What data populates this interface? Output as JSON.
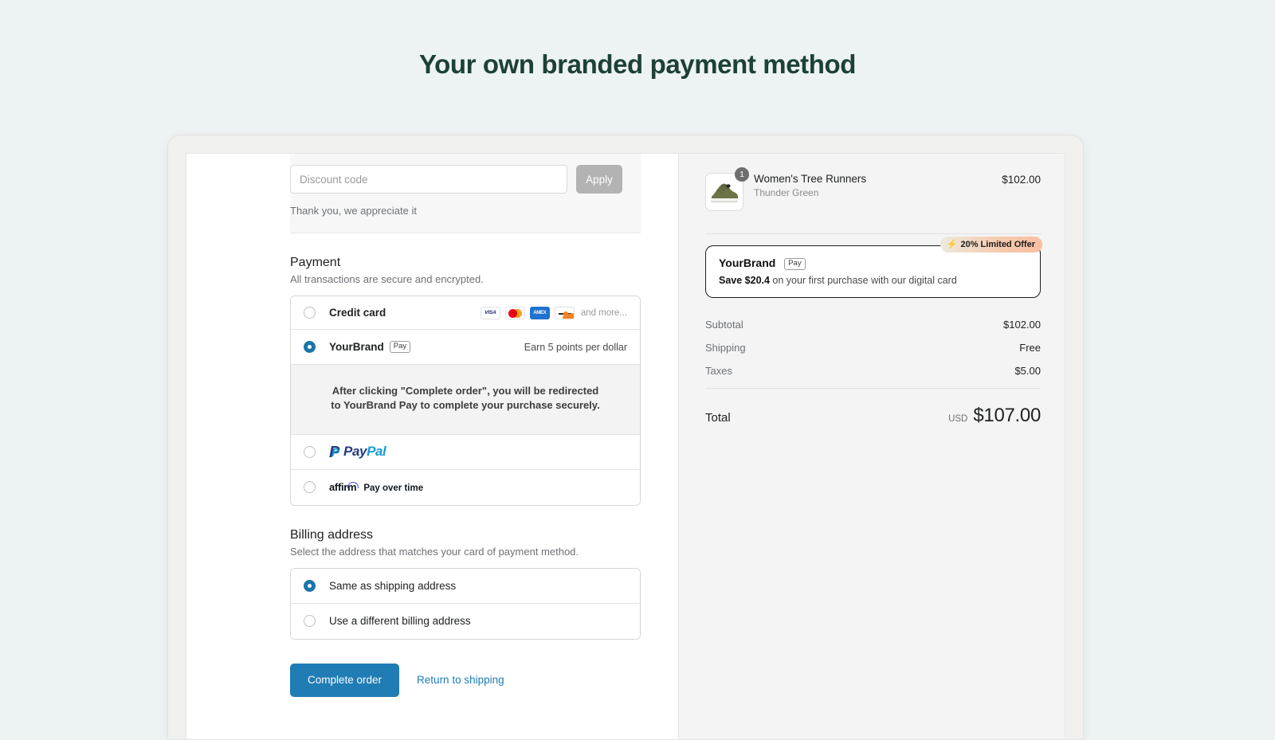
{
  "page": {
    "title": "Your own branded payment method",
    "title_color": "#1d4038",
    "background_color": "#edf3f2",
    "accent_color": "#1f7cb4"
  },
  "discount": {
    "placeholder": "Discount code",
    "value": "",
    "apply_label": "Apply",
    "note": "Thank you, we appreciate it"
  },
  "payment": {
    "title": "Payment",
    "subtitle": "All transactions are secure and encrypted.",
    "methods": [
      {
        "label": "Credit card",
        "selected": false,
        "cards": [
          "VISA",
          "mastercard",
          "AMEX",
          "discover"
        ],
        "and_more": "and more..."
      },
      {
        "label": "YourBrand",
        "tag": "Pay",
        "selected": true,
        "right_note": "Earn 5 points per dollar",
        "redirect_note_line1": "After clicking \"Complete order\", you will be redirected",
        "redirect_note_line2": "to YourBrand Pay to complete your purchase securely."
      },
      {
        "label": "PayPal",
        "logo_part_a": "Pay",
        "logo_part_b": "Pal",
        "selected": false
      },
      {
        "label": "affirm",
        "tagline": "Pay over time",
        "selected": false
      }
    ]
  },
  "billing": {
    "title": "Billing address",
    "subtitle": "Select the address that matches your card of payment method.",
    "options": [
      {
        "label": "Same as shipping address",
        "selected": true
      },
      {
        "label": "Use a different billing address",
        "selected": false
      }
    ]
  },
  "actions": {
    "primary_label": "Complete order",
    "secondary_label": "Return to shipping"
  },
  "summary": {
    "item": {
      "name": "Women's Tree Runners",
      "variant": "Thunder Green",
      "price": "$102.00",
      "quantity": "1"
    },
    "promo": {
      "badge_text": "20% Limited Offer",
      "badge_icon": "bolt-icon",
      "brand": "YourBrand",
      "tag": "Pay",
      "save_text": "Save $20.4",
      "desc_text": " on your first purchase with our digital card",
      "badge_color": "#f8bfa0"
    },
    "lines": [
      {
        "label": "Subtotal",
        "value": "$102.00"
      },
      {
        "label": "Shipping",
        "value": "Free"
      },
      {
        "label": "Taxes",
        "value": "$5.00"
      }
    ],
    "total": {
      "label": "Total",
      "currency": "USD",
      "amount": "$107.00"
    }
  }
}
